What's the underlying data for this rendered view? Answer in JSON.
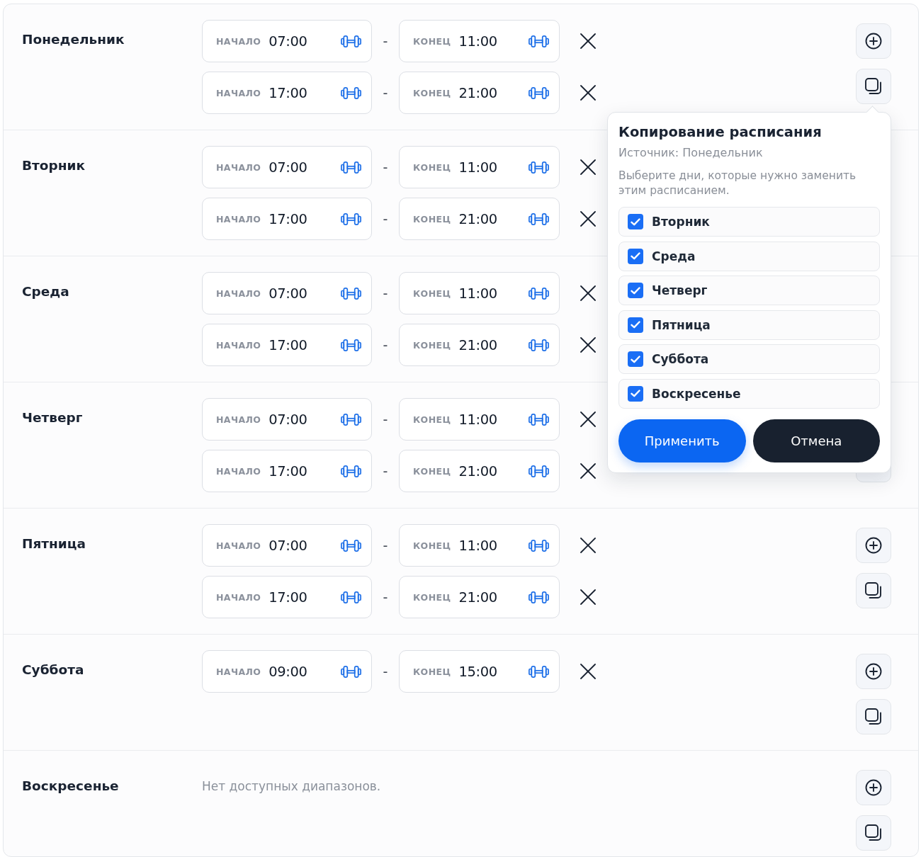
{
  "days": [
    {
      "name": "Понедельник",
      "ranges": [
        {
          "start_label": "НАЧАЛО",
          "start": "07:00",
          "separator": "-",
          "end_label": "КОНЕЦ",
          "end": "11:00"
        },
        {
          "start_label": "НАЧАЛО",
          "start": "17:00",
          "separator": "-",
          "end_label": "КОНЕЦ",
          "end": "21:00"
        }
      ]
    },
    {
      "name": "Вторник",
      "ranges": [
        {
          "start_label": "НАЧАЛО",
          "start": "07:00",
          "separator": "-",
          "end_label": "КОНЕЦ",
          "end": "11:00"
        },
        {
          "start_label": "НАЧАЛО",
          "start": "17:00",
          "separator": "-",
          "end_label": "КОНЕЦ",
          "end": "21:00"
        }
      ]
    },
    {
      "name": "Среда",
      "ranges": [
        {
          "start_label": "НАЧАЛО",
          "start": "07:00",
          "separator": "-",
          "end_label": "КОНЕЦ",
          "end": "11:00"
        },
        {
          "start_label": "НАЧАЛО",
          "start": "17:00",
          "separator": "-",
          "end_label": "КОНЕЦ",
          "end": "21:00"
        }
      ]
    },
    {
      "name": "Четверг",
      "ranges": [
        {
          "start_label": "НАЧАЛО",
          "start": "07:00",
          "separator": "-",
          "end_label": "КОНЕЦ",
          "end": "11:00"
        },
        {
          "start_label": "НАЧАЛО",
          "start": "17:00",
          "separator": "-",
          "end_label": "КОНЕЦ",
          "end": "21:00"
        }
      ]
    },
    {
      "name": "Пятница",
      "ranges": [
        {
          "start_label": "НАЧАЛО",
          "start": "07:00",
          "separator": "-",
          "end_label": "КОНЕЦ",
          "end": "11:00"
        },
        {
          "start_label": "НАЧАЛО",
          "start": "17:00",
          "separator": "-",
          "end_label": "КОНЕЦ",
          "end": "21:00"
        }
      ]
    },
    {
      "name": "Суббота",
      "ranges": [
        {
          "start_label": "НАЧАЛО",
          "start": "09:00",
          "separator": "-",
          "end_label": "КОНЕЦ",
          "end": "15:00"
        }
      ]
    },
    {
      "name": "Воскресенье",
      "empty_text": "Нет доступных диапазонов."
    }
  ],
  "copy_popover": {
    "title": "Копирование расписания",
    "source": "Источник: Понедельник",
    "description": "Выберите дни, которые нужно заменить этим расписанием.",
    "days": [
      {
        "label": "Вторник",
        "checked": true
      },
      {
        "label": "Среда",
        "checked": true
      },
      {
        "label": "Четверг",
        "checked": true
      },
      {
        "label": "Пятница",
        "checked": true
      },
      {
        "label": "Суббота",
        "checked": true
      },
      {
        "label": "Воскресенье",
        "checked": true
      }
    ],
    "apply": "Применить",
    "cancel": "Отмена"
  }
}
